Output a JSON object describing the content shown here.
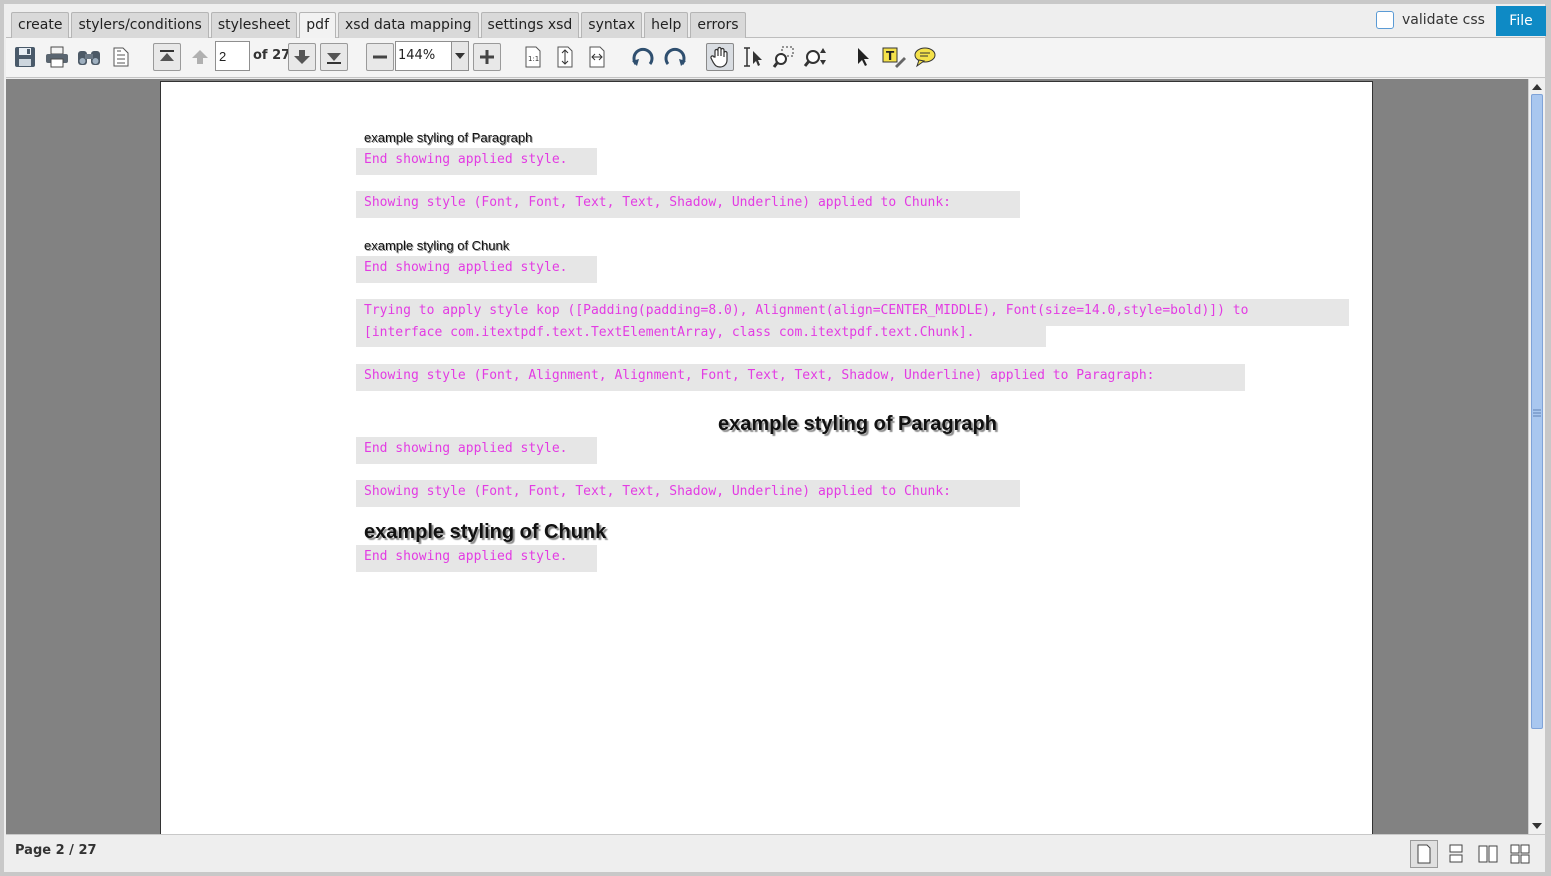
{
  "tabs": [
    {
      "label": "create"
    },
    {
      "label": "stylers/conditions"
    },
    {
      "label": "stylesheet"
    },
    {
      "label": "pdf",
      "active": true
    },
    {
      "label": "xsd data mapping"
    },
    {
      "label": "settings xsd"
    },
    {
      "label": "syntax"
    },
    {
      "label": "help"
    },
    {
      "label": "errors"
    }
  ],
  "header": {
    "validate_label": "validate css",
    "validate_checked": false,
    "file_label": "File"
  },
  "toolbar": {
    "page_value": "2",
    "of_pages": "of 27",
    "zoom_value": "144%",
    "icons": [
      "save-icon",
      "print-icon",
      "search-binoculars-icon",
      "document-properties-icon",
      "first-page-icon",
      "previous-page-icon",
      "next-page-icon",
      "last-page-icon",
      "zoom-out-icon",
      "zoom-in-icon",
      "actual-size-icon",
      "fit-page-icon",
      "fit-width-icon",
      "rotate-left-icon",
      "rotate-right-icon",
      "pan-tool-icon",
      "text-select-icon",
      "marquee-zoom-icon",
      "dynamic-zoom-icon",
      "select-arrow-icon",
      "text-annotation-icon",
      "comment-icon"
    ]
  },
  "document": {
    "lines": [
      {
        "kind": "sample_small",
        "text": "example styling of Paragraph"
      },
      {
        "kind": "mono",
        "text": "End showing applied style."
      },
      {
        "kind": "mono",
        "text": "Showing style (Font, Font, Text, Text, Shadow, Underline) applied to Chunk:"
      },
      {
        "kind": "sample_small",
        "text": "example styling of Chunk"
      },
      {
        "kind": "mono",
        "text": "End showing applied style."
      },
      {
        "kind": "mono",
        "text": "Trying to apply style kop ([Padding(padding=8.0), Alignment(align=CENTER_MIDDLE), Font(size=14.0,style=bold)]) to"
      },
      {
        "kind": "mono",
        "text": "[interface com.itextpdf.text.TextElementArray, class com.itextpdf.text.Chunk]."
      },
      {
        "kind": "mono",
        "text": "Showing style (Font, Alignment, Alignment, Font, Text, Text, Shadow, Underline) applied to Paragraph:"
      },
      {
        "kind": "sample_big",
        "text": "example styling of Paragraph"
      },
      {
        "kind": "mono",
        "text": "End showing applied style."
      },
      {
        "kind": "mono",
        "text": "Showing style (Font, Font, Text, Text, Shadow, Underline) applied to Chunk:"
      },
      {
        "kind": "sample_big",
        "text": "example styling of Chunk"
      },
      {
        "kind": "mono",
        "text": "End showing applied style."
      }
    ]
  },
  "status": {
    "page_text": "Page 2 / 27"
  },
  "colors": {
    "accent": "#0e8ac5",
    "mono_text": "#e33ce3",
    "highlight": "#e6e6e6",
    "viewer_bg": "#828282"
  }
}
